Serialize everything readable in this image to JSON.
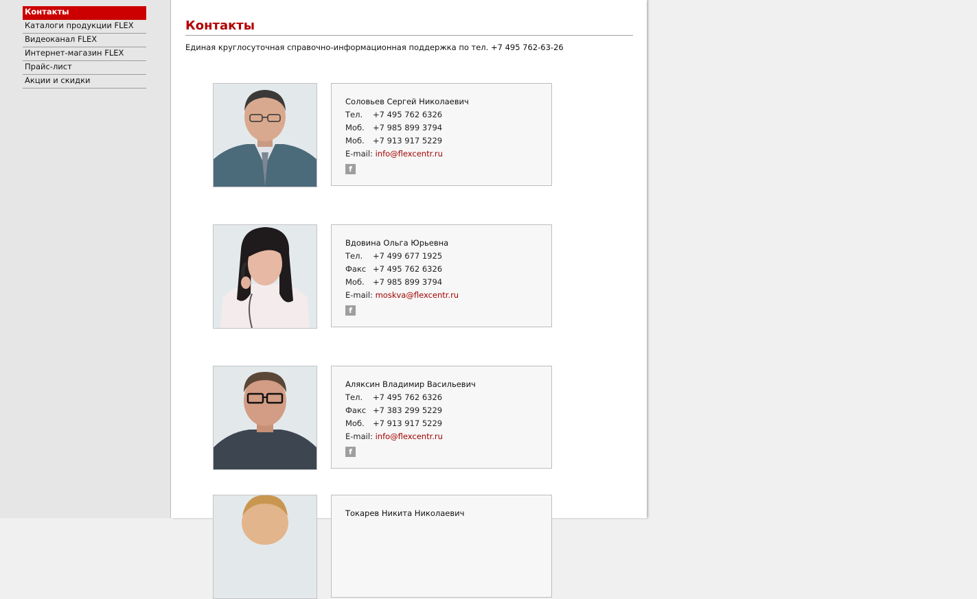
{
  "nav": {
    "items": [
      {
        "label": "Контакты",
        "active": true
      },
      {
        "label": "Каталоги продукции FLEX",
        "active": false
      },
      {
        "label": "Видеоканал FLEX",
        "active": false
      },
      {
        "label": "Интернет-магазин FLEX",
        "active": false
      },
      {
        "label": "Прайс-лист",
        "active": false
      },
      {
        "label": "Акции и скидки",
        "active": false
      }
    ]
  },
  "page": {
    "title": "Контакты",
    "support_text": "Единая круглосуточная справочно-информационная поддержка по тел. +7 495 762-63-26"
  },
  "contacts": [
    {
      "name": "Соловьев Сергей Николаевич",
      "rows": [
        {
          "label": "Тел.",
          "value": "+7 495 762 6326"
        },
        {
          "label": "Моб.",
          "value": "+7 985 899 3794"
        },
        {
          "label": "Моб.",
          "value": "+7 913 917 5229"
        }
      ],
      "email_label": "E-mail:",
      "email": "info@flexcentr.ru",
      "social_icon": "facebook-icon"
    },
    {
      "name": "Вдовина Ольга Юрьевна",
      "rows": [
        {
          "label": "Тел.",
          "value": "+7 499 677 1925"
        },
        {
          "label": "Факс",
          "value": "+7 495 762 6326"
        },
        {
          "label": "Моб.",
          "value": "+7 985 899 3794"
        }
      ],
      "email_label": "E-mail:",
      "email": "moskva@flexcentr.ru",
      "social_icon": "facebook-icon"
    },
    {
      "name": "Аляксин Владимир Васильевич",
      "rows": [
        {
          "label": "Тел.",
          "value": "+7 495 762 6326"
        },
        {
          "label": "Факс",
          "value": "+7 383 299 5229"
        },
        {
          "label": "Моб.",
          "value": "+7 913 917 5229"
        }
      ],
      "email_label": "E-mail:",
      "email": "info@flexcentr.ru",
      "social_icon": "facebook-icon"
    },
    {
      "name": "Токарев Никита Николаевич"
    }
  ],
  "colors": {
    "accent": "#cc0000",
    "title": "#b30000",
    "link": "#a30000"
  }
}
